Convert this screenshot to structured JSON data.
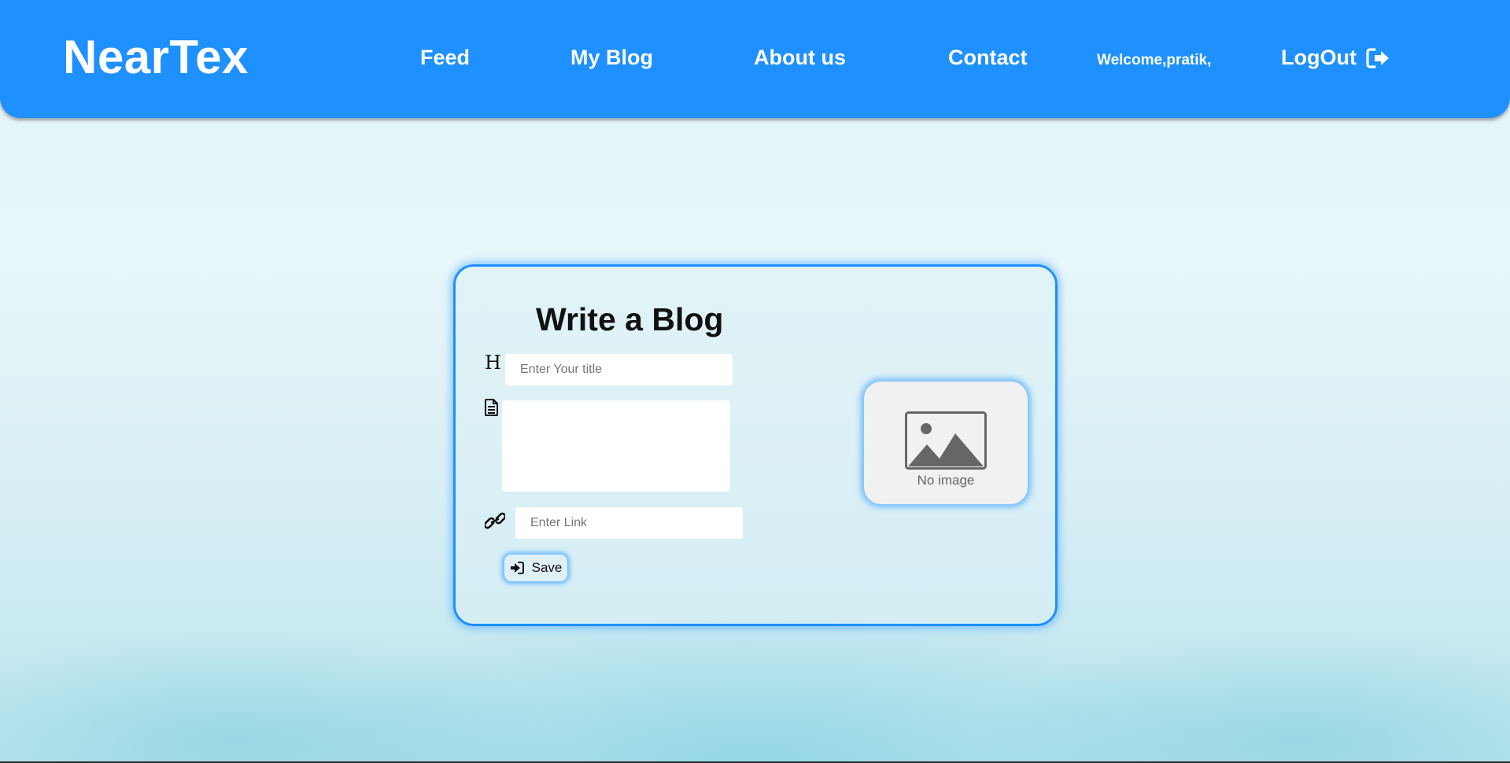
{
  "nav": {
    "brand": "NearTex",
    "links": [
      "Feed",
      "My Blog",
      "About us",
      "Contact"
    ],
    "welcome": "Welcome,pratik,",
    "logout": "LogOut",
    "bg_color": "#1e90ff"
  },
  "form": {
    "title": "Write a Blog",
    "title_placeholder": "Enter Your title",
    "link_placeholder": "Enter Link",
    "save_label": "Save"
  },
  "preview": {
    "no_image": "No image"
  },
  "icons": {
    "title": "heading-icon",
    "content": "document-icon",
    "link": "link-icon",
    "save": "sign-in-icon",
    "logout": "sign-out-icon",
    "preview": "image-placeholder-icon"
  }
}
